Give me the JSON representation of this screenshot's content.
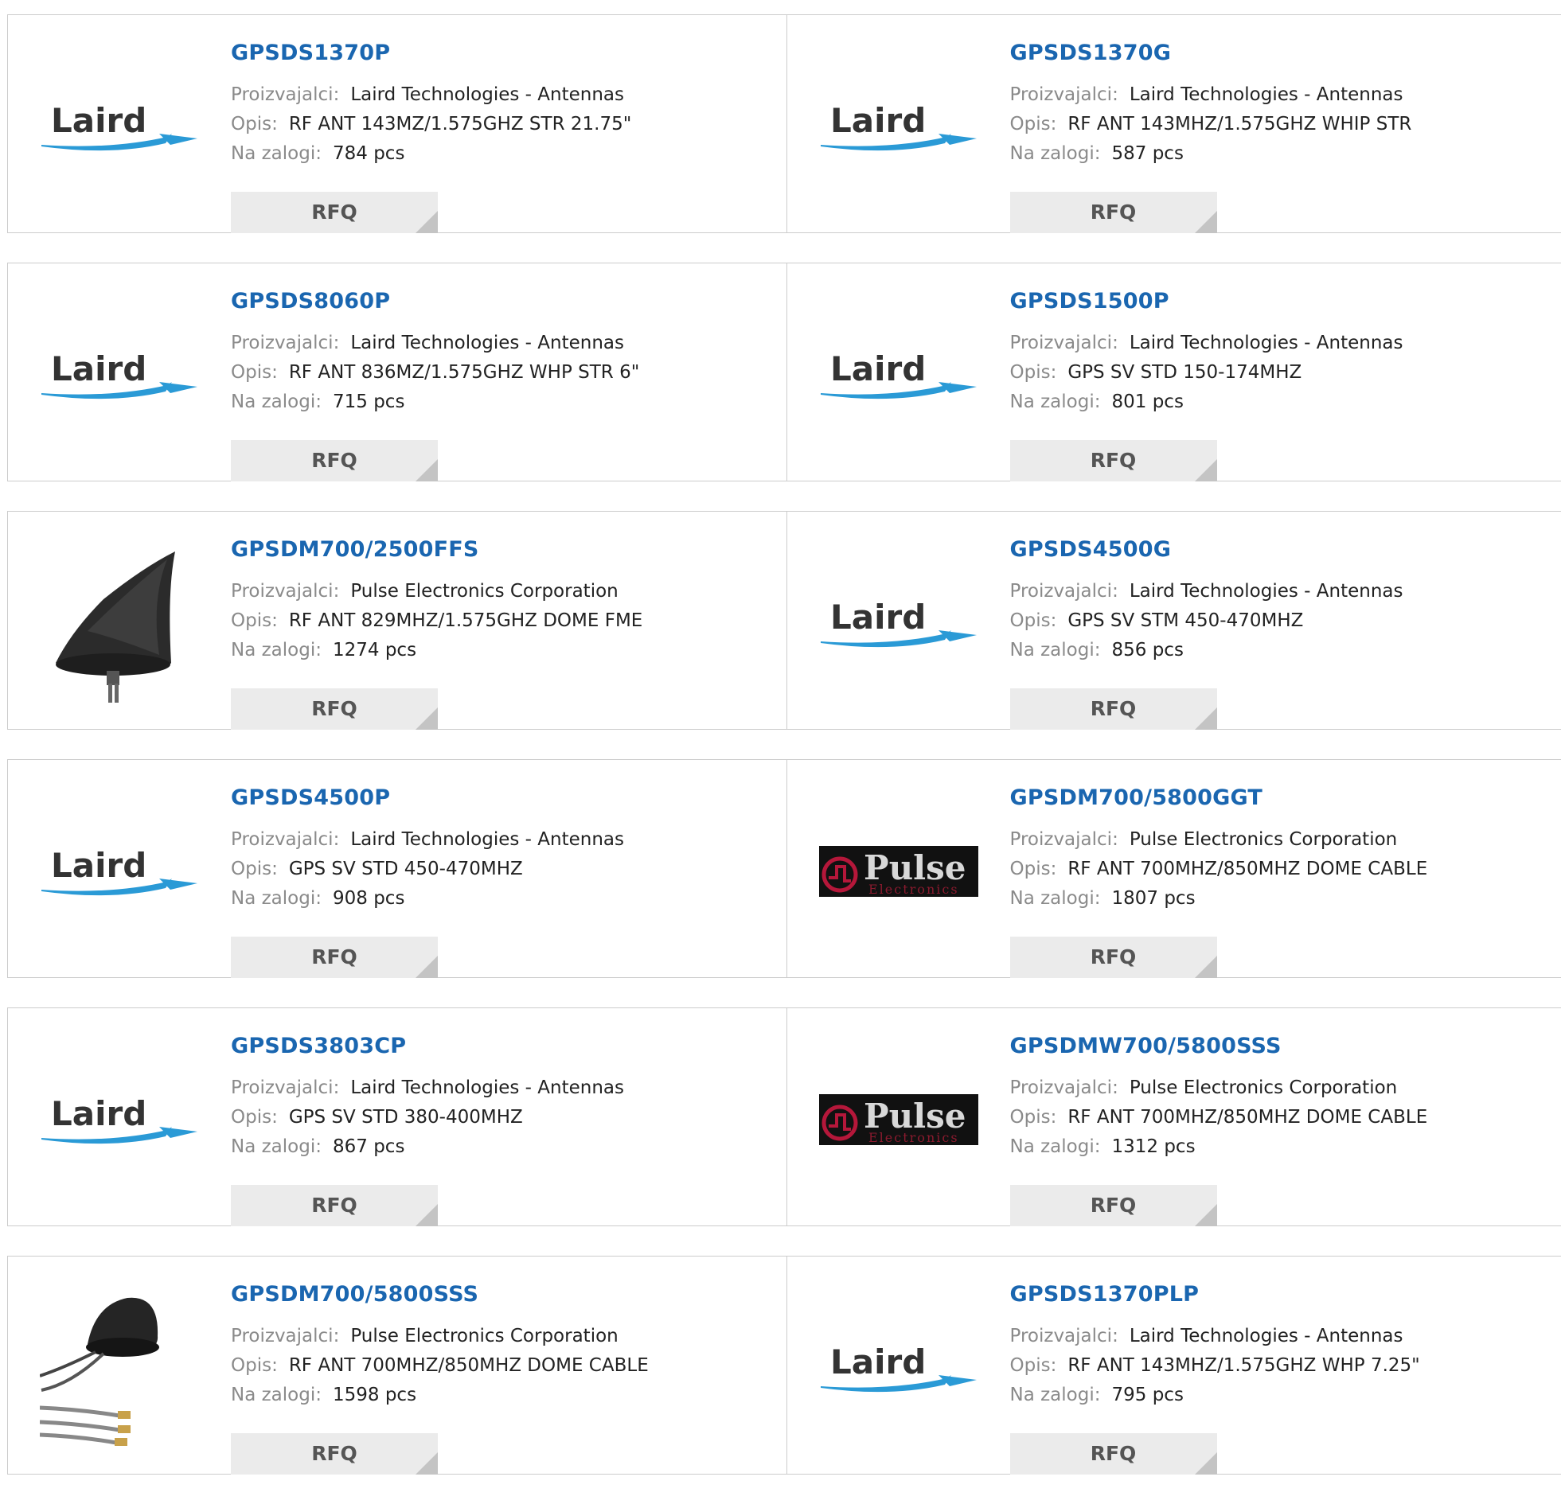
{
  "labels": {
    "manufacturer": "Proizvajalci:",
    "description": "Opis:",
    "stock": "Na zalogi:",
    "rfq": "RFQ"
  },
  "logo_text": {
    "laird": "Laird",
    "pulse": "Pulse",
    "pulse_sub": "Electronics"
  },
  "colors": {
    "part_link": "#1a66b0",
    "label_gray": "#8a8a8a",
    "rfq_bg": "#ebebeb",
    "border": "#cccccc"
  },
  "products": [
    {
      "part": "GPSDS1370P",
      "image": "laird-logo",
      "manufacturer": "Laird Technologies - Antennas",
      "description": "RF ANT 143MZ/1.575GHZ STR 21.75\"",
      "stock": "784 pcs"
    },
    {
      "part": "GPSDS1370G",
      "image": "laird-logo",
      "manufacturer": "Laird Technologies - Antennas",
      "description": "RF ANT 143MHZ/1.575GHZ WHIP STR",
      "stock": "587 pcs"
    },
    {
      "part": "GPSDS8060P",
      "image": "laird-logo",
      "manufacturer": "Laird Technologies - Antennas",
      "description": "RF ANT 836MZ/1.575GHZ WHP STR 6\"",
      "stock": "715 pcs"
    },
    {
      "part": "GPSDS1500P",
      "image": "laird-logo",
      "manufacturer": "Laird Technologies - Antennas",
      "description": "GPS SV STD 150-174MHZ",
      "stock": "801 pcs"
    },
    {
      "part": "GPSDM700/2500FFS",
      "image": "shark-fin-antenna-photo",
      "manufacturer": "Pulse Electronics Corporation",
      "description": "RF ANT 829MHZ/1.575GHZ DOME FME",
      "stock": "1274 pcs"
    },
    {
      "part": "GPSDS4500G",
      "image": "laird-logo",
      "manufacturer": "Laird Technologies - Antennas",
      "description": "GPS SV STM 450-470MHZ",
      "stock": "856 pcs"
    },
    {
      "part": "GPSDS4500P",
      "image": "laird-logo",
      "manufacturer": "Laird Technologies - Antennas",
      "description": "GPS SV STD 450-470MHZ",
      "stock": "908 pcs"
    },
    {
      "part": "GPSDM700/5800GGT",
      "image": "pulse-logo",
      "manufacturer": "Pulse Electronics Corporation",
      "description": "RF ANT 700MHZ/850MHZ DOME CABLE",
      "stock": "1807 pcs"
    },
    {
      "part": "GPSDS3803CP",
      "image": "laird-logo",
      "manufacturer": "Laird Technologies - Antennas",
      "description": "GPS SV STD 380-400MHZ",
      "stock": "867 pcs"
    },
    {
      "part": "GPSDMW700/5800SSS",
      "image": "pulse-logo",
      "manufacturer": "Pulse Electronics Corporation",
      "description": "RF ANT 700MHZ/850MHZ DOME CABLE",
      "stock": "1312 pcs"
    },
    {
      "part": "GPSDM700/5800SSS",
      "image": "dome-antenna-photo",
      "manufacturer": "Pulse Electronics Corporation",
      "description": "RF ANT 700MHZ/850MHZ DOME CABLE",
      "stock": "1598 pcs"
    },
    {
      "part": "GPSDS1370PLP",
      "image": "laird-logo",
      "manufacturer": "Laird Technologies - Antennas",
      "description": "RF ANT 143MHZ/1.575GHZ WHP 7.25\"",
      "stock": "795 pcs"
    }
  ]
}
